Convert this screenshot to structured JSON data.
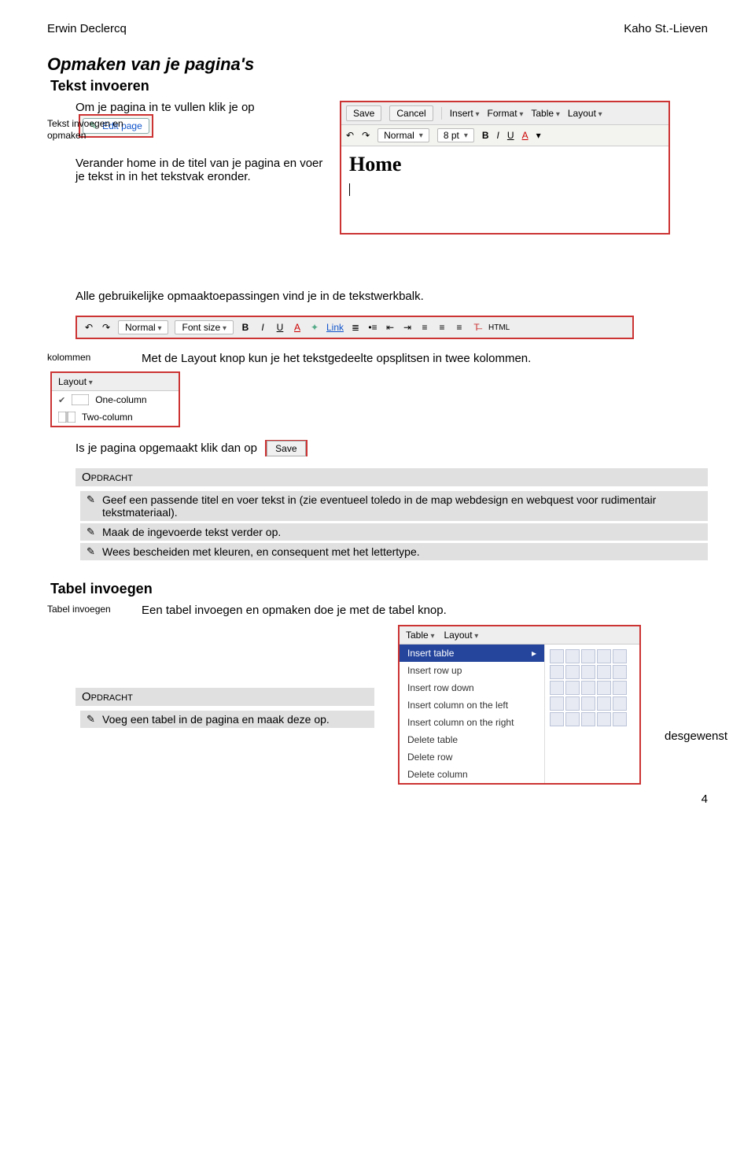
{
  "header": {
    "left": "Erwin Declercq",
    "right": "Kaho St.-Lieven"
  },
  "sec1": {
    "title": "Opmaken van je pagina's",
    "sub": "Tekst invoeren",
    "side": "Tekst invoegen en\nopmaken",
    "p1": "Om je pagina in te vullen klik je op",
    "editpage_label": "Edit page",
    "p2": "Verander home in de titel van je pagina en voer je tekst in in het tekstvak eronder.",
    "p3": "Alle gebruikelijke opmaaktoepassingen vind je in de tekstwerkbalk."
  },
  "editor": {
    "save": "Save",
    "cancel": "Cancel",
    "insert": "Insert",
    "format": "Format",
    "table": "Table",
    "layout": "Layout",
    "font_normal": "Normal",
    "font_size": "8 pt",
    "home": "Home"
  },
  "toolbar": {
    "normal": "Normal",
    "fontsize": "Font size",
    "link": "Link",
    "html": "HTML"
  },
  "kolommen": {
    "side": "kolommen",
    "text": "Met de Layout knop kun je het tekstgedeelte opsplitsen in twee kolommen.",
    "layout_btn": "Layout",
    "one": "One-column",
    "two": "Two-column"
  },
  "savepara": {
    "text": "Is je pagina opgemaakt klik dan op",
    "save": "Save"
  },
  "opdracht1": {
    "title": "Opdracht",
    "items": [
      "Geef een passende titel en voer tekst in (zie eventueel toledo in de map webdesign en webquest voor rudimentair tekstmateriaal).",
      "Maak de ingevoerde tekst verder op.",
      "Wees bescheiden met kleuren, en consequent met het lettertype."
    ]
  },
  "sec2": {
    "title": "Tabel invoegen",
    "side": "Tabel invoegen",
    "text": "Een tabel invoegen en opmaken doe je met de tabel knop."
  },
  "tablemenu": {
    "table": "Table",
    "layout": "Layout",
    "items": [
      "Insert table",
      "Insert row up",
      "Insert row down",
      "Insert column on the left",
      "Insert column on the right",
      "Delete table",
      "Delete row",
      "Delete column"
    ]
  },
  "opdracht2": {
    "title": "Opdracht",
    "left": "Voeg een tabel in de pagina en maak deze op.",
    "right": "desgewenst"
  },
  "pagenum": "4"
}
